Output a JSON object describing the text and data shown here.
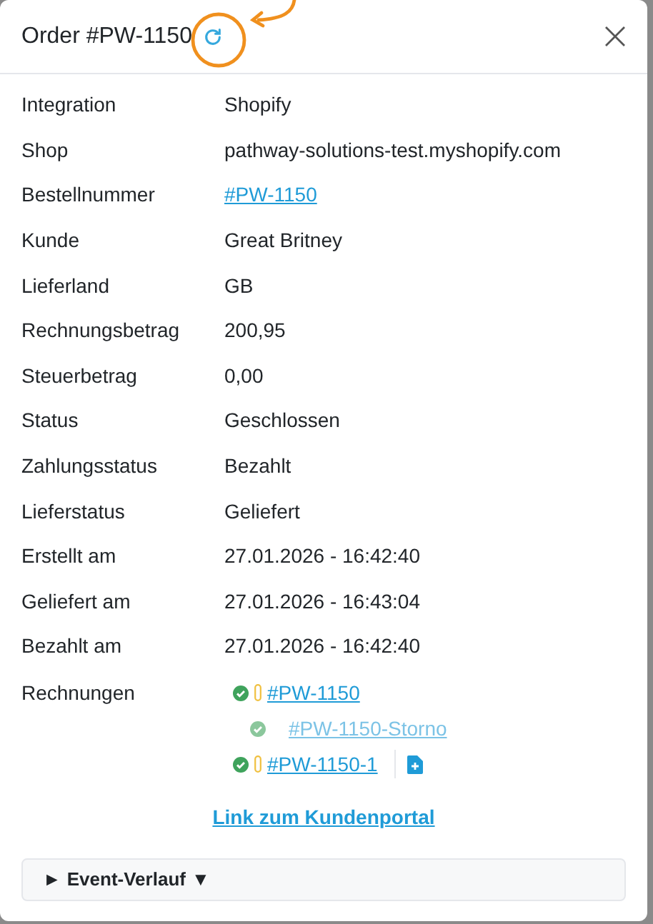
{
  "dialog": {
    "title": "Order #PW-1150"
  },
  "fields": [
    {
      "label": "Integration",
      "value": "Shopify"
    },
    {
      "label": "Shop",
      "value": "pathway-solutions-test.myshopify.com"
    },
    {
      "label": "Bestellnummer",
      "value": "#PW-1150",
      "kind": "link"
    },
    {
      "label": "Kunde",
      "value": "Great Britney"
    },
    {
      "label": "Lieferland",
      "value": "GB"
    },
    {
      "label": "Rechnungsbetrag",
      "value": "200,95"
    },
    {
      "label": "Steuerbetrag",
      "value": "0,00"
    },
    {
      "label": "Status",
      "value": "Geschlossen"
    },
    {
      "label": "Zahlungsstatus",
      "value": "Bezahlt"
    },
    {
      "label": "Lieferstatus",
      "value": "Geliefert"
    },
    {
      "label": "Erstellt am",
      "value": "27.01.2026 - 16:42:40"
    },
    {
      "label": "Geliefert am",
      "value": "27.01.2026 - 16:43:04"
    },
    {
      "label": "Bezahlt am",
      "value": "27.01.2026 - 16:42:40"
    }
  ],
  "invoices": {
    "label": "Rechnungen",
    "items": [
      {
        "number": "#PW-1150",
        "attachment": true,
        "muted": false,
        "upload": false,
        "children": [
          {
            "number": "#PW-1150-Storno",
            "attachment": false,
            "muted": true,
            "upload": false
          }
        ]
      },
      {
        "number": "#PW-1150-1",
        "attachment": true,
        "muted": false,
        "upload": true
      }
    ]
  },
  "portal_link": "Link zum Kundenportal",
  "event_history": {
    "label": "Event-Verlauf",
    "marker": "►",
    "caret": "▼"
  }
}
